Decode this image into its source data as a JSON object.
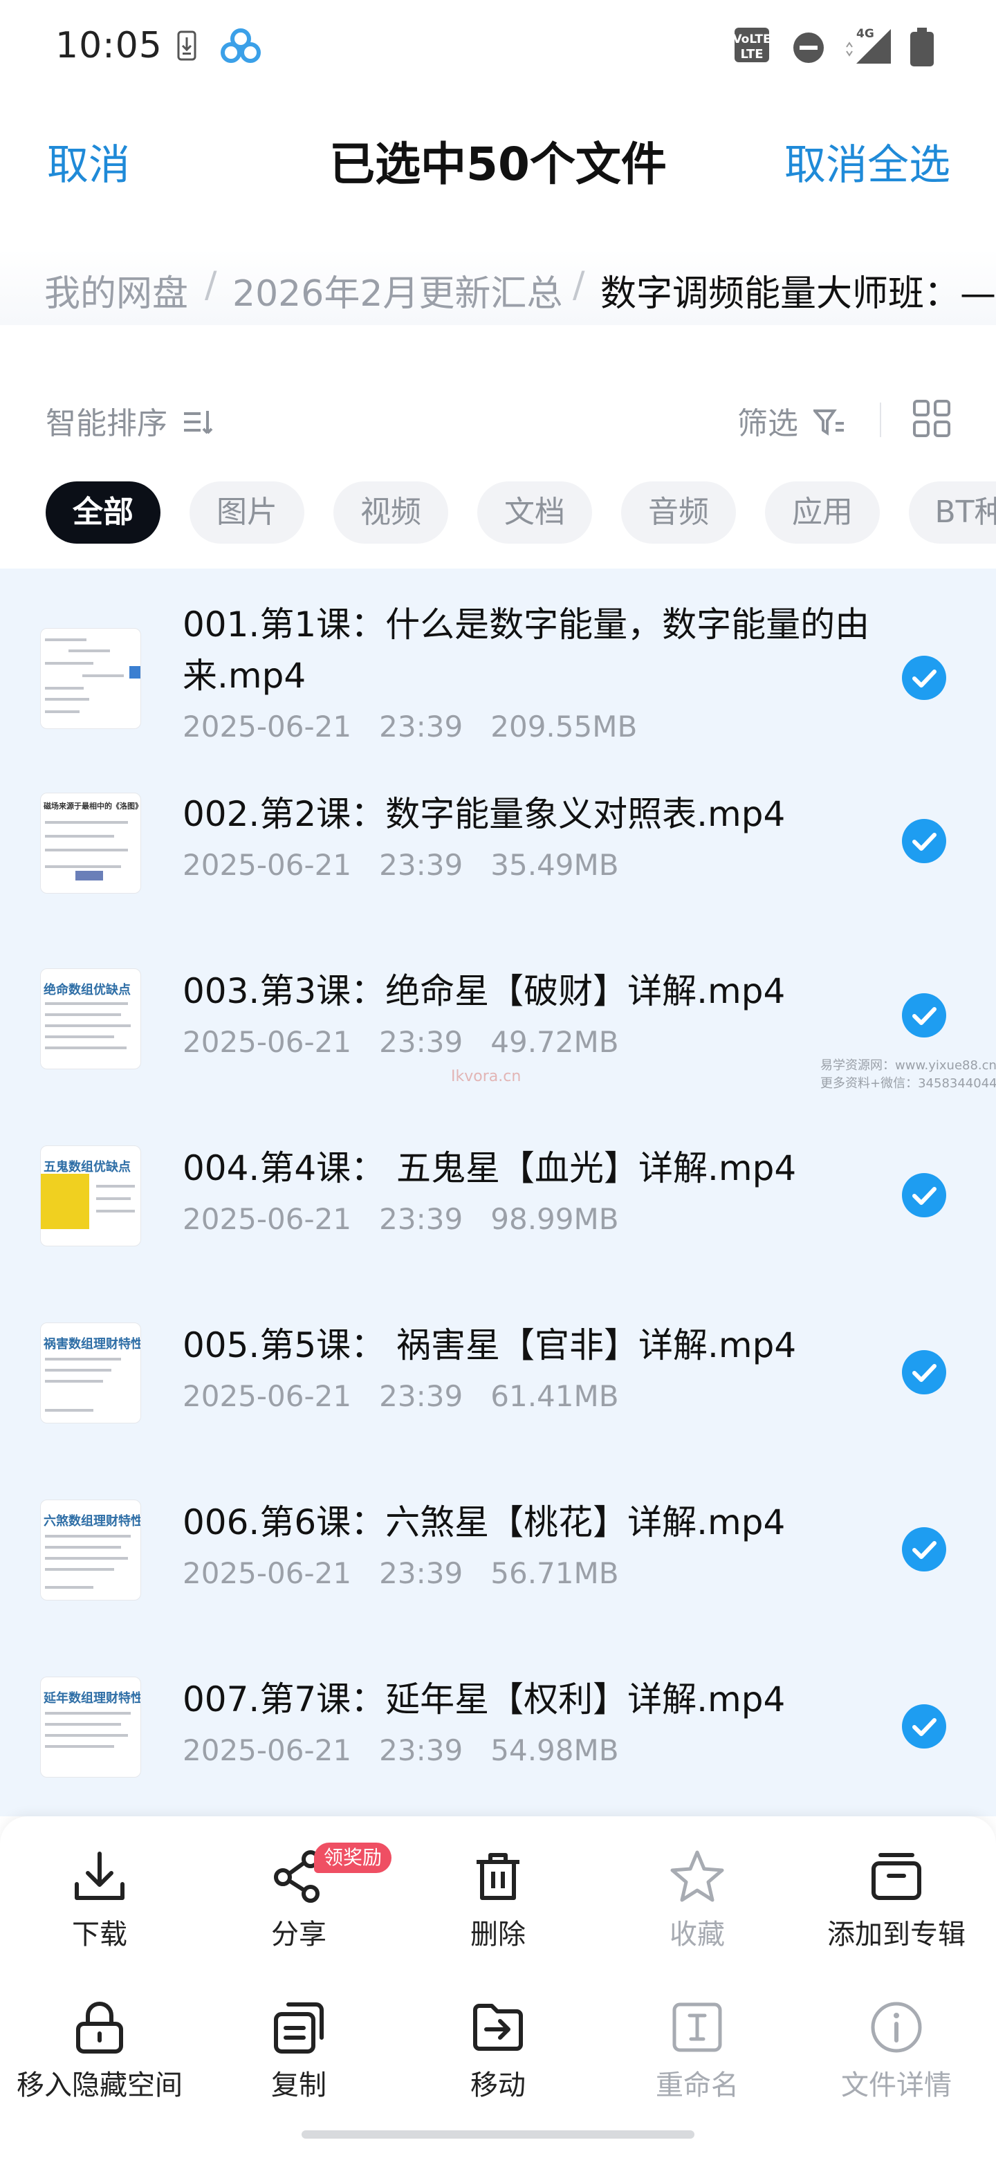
{
  "status_bar": {
    "time": "10:05",
    "icons": [
      "download-icon",
      "app-logo-icon",
      "volte-icon",
      "dnd-icon",
      "signal-4g-icon",
      "battery-icon"
    ],
    "network": "4G"
  },
  "header": {
    "cancel": "取消",
    "title": "已选中50个文件",
    "deselect_all": "取消全选"
  },
  "breadcrumb": {
    "items": [
      "我的网盘",
      "2026年2月更新汇总",
      "数字调频能量大师班：—"
    ],
    "separator": "/"
  },
  "toolbar": {
    "sort_label": "智能排序",
    "filter_label": "筛选"
  },
  "chips": [
    "全部",
    "图片",
    "视频",
    "文档",
    "音频",
    "应用",
    "BT种子"
  ],
  "files": [
    {
      "name": "001.第1课：什么是数字能量，数字能量的由来.mp4",
      "date": "2025-06-21",
      "time": "23:39",
      "size": "209.55MB"
    },
    {
      "name": "002.第2课：数字能量象义对照表.mp4",
      "date": "2025-06-21",
      "time": "23:39",
      "size": "35.49MB",
      "thumb_title": "磁场来源于最相中的《洛图》"
    },
    {
      "name": "003.第3课：绝命星【破财】详解.mp4",
      "date": "2025-06-21",
      "time": "23:39",
      "size": "49.72MB",
      "thumb_title": "绝命数组优缺点"
    },
    {
      "name": "004.第4课： 五鬼星【血光】详解.mp4",
      "date": "2025-06-21",
      "time": "23:39",
      "size": "98.99MB",
      "thumb_title": "五鬼数组优缺点"
    },
    {
      "name": "005.第5课： 祸害星【官非】详解.mp4",
      "date": "2025-06-21",
      "time": "23:39",
      "size": "61.41MB",
      "thumb_title": "祸害数组理财特性"
    },
    {
      "name": "006.第6课：六煞星【桃花】详解.mp4",
      "date": "2025-06-21",
      "time": "23:39",
      "size": "56.71MB",
      "thumb_title": "六煞数组理财特性"
    },
    {
      "name": "007.第7课：延年星【权利】详解.mp4",
      "date": "2025-06-21",
      "time": "23:39",
      "size": "54.98MB",
      "thumb_title": "延年数组理财特性"
    }
  ],
  "watermark": {
    "line1": "易学资源网：www.yixue88.cn",
    "line2": "更多资料+微信：3458344044",
    "center": "Ikvora.cn"
  },
  "actions_row1": [
    {
      "label": "下载",
      "icon": "download-icon"
    },
    {
      "label": "分享",
      "icon": "share-icon",
      "badge": "领奖励"
    },
    {
      "label": "删除",
      "icon": "trash-icon"
    },
    {
      "label": "收藏",
      "icon": "star-icon",
      "disabled": true
    },
    {
      "label": "添加到专辑",
      "icon": "album-icon"
    }
  ],
  "actions_row2": [
    {
      "label": "移入隐藏空间",
      "icon": "lock-icon"
    },
    {
      "label": "复制",
      "icon": "copy-icon"
    },
    {
      "label": "移动",
      "icon": "move-icon"
    },
    {
      "label": "重命名",
      "icon": "rename-icon",
      "disabled": true
    },
    {
      "label": "文件详情",
      "icon": "info-icon",
      "disabled": true
    }
  ],
  "colors": {
    "accent": "#1f8ad8",
    "check": "#1e9df1",
    "list_bg": "#eef5fd",
    "badge": "#ef4f63"
  }
}
